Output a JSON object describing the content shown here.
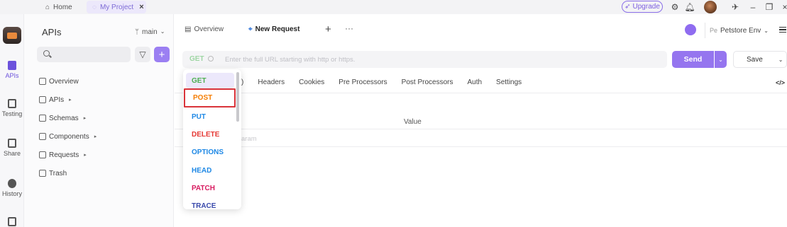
{
  "topbar": {
    "home_label": "Home",
    "project_label": "My Project",
    "upgrade_label": "Upgrade"
  },
  "rail": {
    "items": [
      {
        "label": "APIs",
        "icon": "apis-icon",
        "active": true
      },
      {
        "label": "Testing",
        "icon": "testing-icon",
        "active": false
      },
      {
        "label": "Share",
        "icon": "share-icon",
        "active": false
      },
      {
        "label": "History",
        "icon": "history-icon",
        "active": false
      }
    ]
  },
  "sidebar": {
    "title": "APIs",
    "branch": "main",
    "tree": [
      {
        "label": "Overview",
        "icon": "overview-icon",
        "has_caret": false
      },
      {
        "label": "APIs",
        "icon": "apis-folder-icon",
        "has_caret": true
      },
      {
        "label": "Schemas",
        "icon": "schemas-icon",
        "has_caret": true
      },
      {
        "label": "Components",
        "icon": "components-icon",
        "has_caret": true
      },
      {
        "label": "Requests",
        "icon": "requests-icon",
        "has_caret": true
      },
      {
        "label": "Trash",
        "icon": "trash-icon",
        "has_caret": false
      }
    ]
  },
  "main_tabs": {
    "overview_label": "Overview",
    "new_request_label": "New Request",
    "env_label": "Petstore Env"
  },
  "request": {
    "method": "GET",
    "url_value": "",
    "url_placeholder": "Enter the full URL starting with http or https.",
    "send_label": "Send",
    "save_label": "Save"
  },
  "request_tabs": [
    "Headers",
    "Cookies",
    "Pre Processors",
    "Post Processors",
    "Auth",
    "Settings"
  ],
  "params_table": {
    "value_header": "Value",
    "row_placeholder": "aram"
  },
  "method_dropdown": {
    "items": [
      {
        "label": "GET",
        "color": "#4caf50",
        "selected": true,
        "highlighted": false
      },
      {
        "label": "POST",
        "color": "#f57c00",
        "selected": false,
        "highlighted": true
      },
      {
        "label": "PUT",
        "color": "#1e88e5",
        "selected": false,
        "highlighted": false
      },
      {
        "label": "DELETE",
        "color": "#e53935",
        "selected": false,
        "highlighted": false
      },
      {
        "label": "OPTIONS",
        "color": "#1e88e5",
        "selected": false,
        "highlighted": false
      },
      {
        "label": "HEAD",
        "color": "#1e88e5",
        "selected": false,
        "highlighted": false
      },
      {
        "label": "PATCH",
        "color": "#d81b60",
        "selected": false,
        "highlighted": false
      },
      {
        "label": "TRACE",
        "color": "#3949ab",
        "selected": false,
        "highlighted": false
      }
    ]
  },
  "colors": {
    "accent": "#9575ef",
    "highlight_border": "#d9343a"
  }
}
